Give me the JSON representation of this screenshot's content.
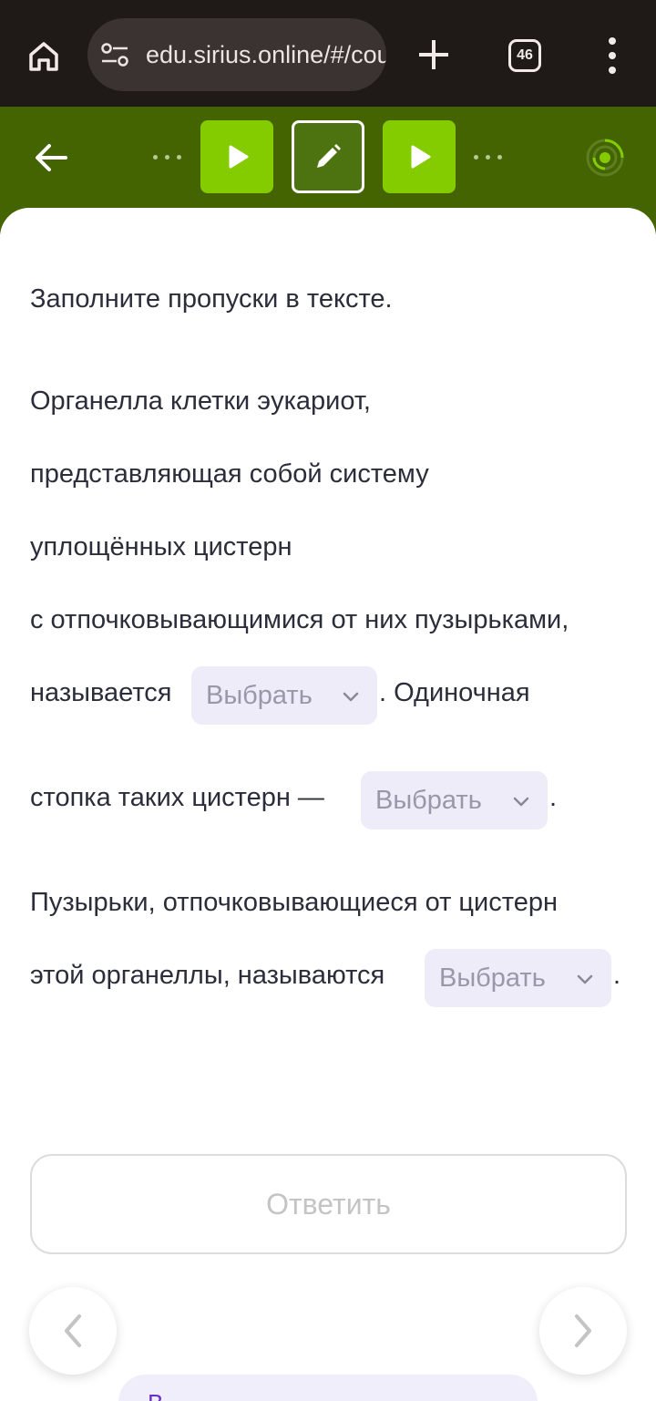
{
  "browser": {
    "url": "edu.sirius.online/#/course",
    "tab_count": "46",
    "icons": [
      "home-icon",
      "site-settings-icon",
      "plus-icon",
      "tabs-icon",
      "more-vert-icon"
    ]
  },
  "header": {
    "icons": [
      "arrow-back-icon",
      "play-icon",
      "pencil-icon",
      "play-icon",
      "progress-ring-icon"
    ],
    "colors": {
      "bar": "#436400",
      "step_active": "#84cc00",
      "step_current": "#4d7310"
    }
  },
  "task": {
    "instruction": "Заполните пропуски в тексте.",
    "lines": [
      "Органелла клетки эукариот,",
      "представляющая собой систему",
      "уплощённых цистерн",
      "с отпочковывающимися от них пузырьками,"
    ],
    "p1_before": "называется",
    "p1_after": ". Одиночная",
    "p2_before": "стопка таких цистерн —",
    "p2_after": ".",
    "p3_line1": "Пузырьки, отпочковывающиеся от цистерн",
    "p3_before": "этой органеллы, называются",
    "p3_after": ".",
    "select_placeholder": "Выбрать"
  },
  "actions": {
    "answer_label": "Ответить",
    "bottom_label": "В"
  }
}
